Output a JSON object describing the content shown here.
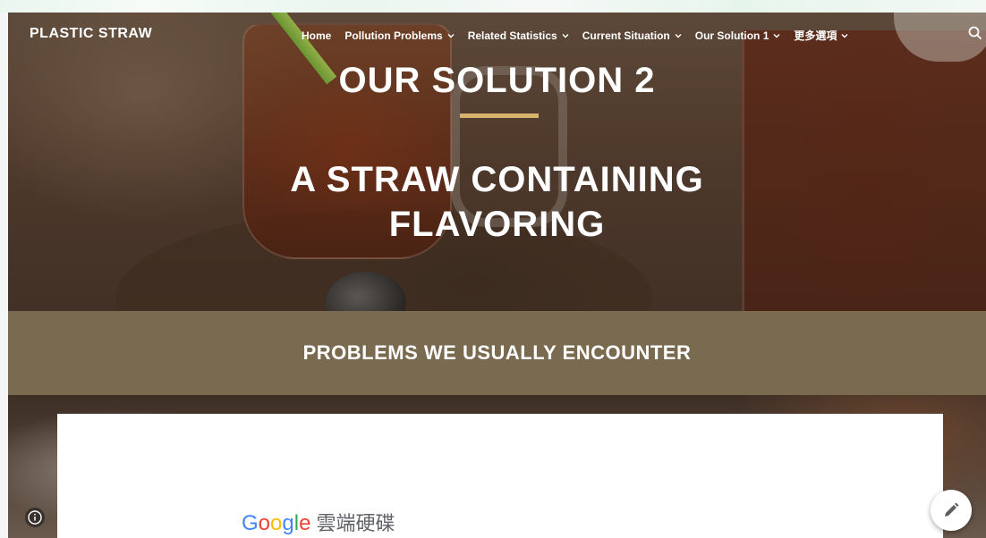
{
  "site": {
    "brand": "PLASTIC STRAW"
  },
  "nav": {
    "items": [
      {
        "label": "Home",
        "has_dropdown": false
      },
      {
        "label": "Pollution Problems",
        "has_dropdown": true
      },
      {
        "label": "Related Statistics",
        "has_dropdown": true
      },
      {
        "label": "Current Situation",
        "has_dropdown": true
      },
      {
        "label": "Our Solution 1",
        "has_dropdown": true
      },
      {
        "label": "更多選項",
        "has_dropdown": true
      }
    ],
    "search_icon": "search-icon"
  },
  "hero": {
    "title": "OUR SOLUTION 2",
    "subtitle_line1": "A STRAW CONTAINING",
    "subtitle_line2": "FLAVORING",
    "accent_color": "#d7b36b"
  },
  "section": {
    "heading": "PROBLEMS WE USUALLY ENCOUNTER",
    "band_color": "#7a6a4f"
  },
  "embed": {
    "logo_letters": [
      "G",
      "o",
      "o",
      "g",
      "l",
      "e"
    ],
    "logo_colors": [
      "#4285f4",
      "#ea4335",
      "#fbbc05",
      "#4285f4",
      "#34a853",
      "#ea4335"
    ],
    "product_name": "雲端硬碟"
  },
  "controls": {
    "info_icon": "info-icon",
    "edit_icon": "pencil-icon"
  }
}
